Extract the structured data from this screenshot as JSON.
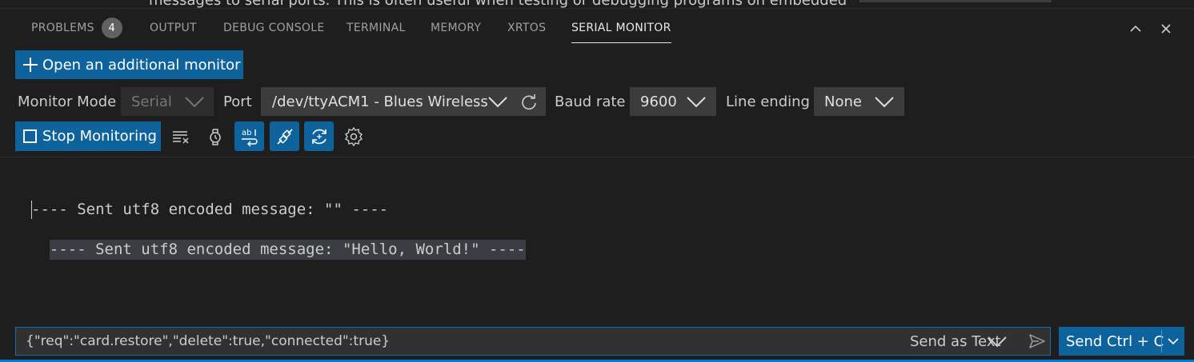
{
  "background_text": "messages to serial ports. This is often useful when testing or debugging programs on embedded",
  "tabs": [
    {
      "label": "PROBLEMS",
      "badge": "4"
    },
    {
      "label": "OUTPUT"
    },
    {
      "label": "DEBUG CONSOLE"
    },
    {
      "label": "TERMINAL"
    },
    {
      "label": "MEMORY"
    },
    {
      "label": "XRTOS"
    },
    {
      "label": "SERIAL MONITOR",
      "active": true
    }
  ],
  "panel_controls": {
    "maximize_icon": "chevron-up-icon",
    "close_icon": "close-icon"
  },
  "open_monitor_label": "Open an additional monitor",
  "settings_row": {
    "monitor_mode_label": "Monitor Mode",
    "monitor_mode_value": "Serial",
    "port_label": "Port",
    "port_value": "/dev/ttyACM1 - Blues Wireless",
    "baud_label": "Baud rate",
    "baud_value": "9600",
    "line_ending_label": "Line ending",
    "line_ending_value": "None"
  },
  "toolbar": {
    "stop_label": "Stop Monitoring",
    "icons": [
      "clear-output-icon",
      "timestamp-icon",
      "word-wrap-icon",
      "toggle-connection-icon",
      "auto-reconnect-icon",
      "settings-gear-icon"
    ]
  },
  "terminal_lines": [
    "---- Sent utf8 encoded message: \"\" ----",
    "---- Sent utf8 encoded message: \"Hello, World!\" ----"
  ],
  "message_input": {
    "value": "{\"req\":\"card.restore\",\"delete\":true,\"connected\":true}",
    "send_mode": "Send as Text"
  },
  "send_button_label": "Send Ctrl + C",
  "colors": {
    "accent": "#0e639c",
    "panel_bg": "#1e1e1e",
    "input_bg": "#3c3c3c",
    "status_bar": "#007acc"
  }
}
